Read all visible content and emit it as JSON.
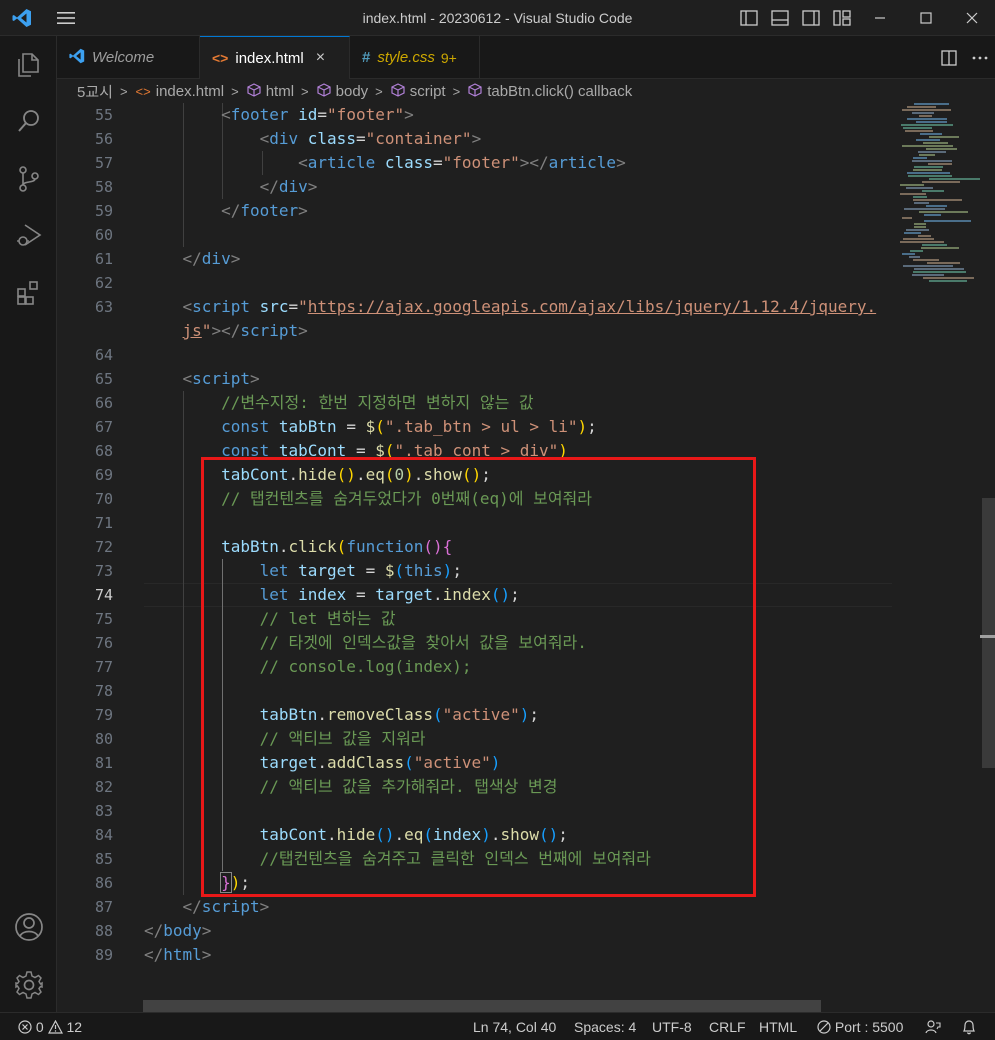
{
  "window": {
    "title": "index.html - 20230612 - Visual Studio Code"
  },
  "tabs": [
    {
      "label": "Welcome",
      "icon": "vscode-logo-icon"
    },
    {
      "label": "index.html",
      "icon": "html-icon",
      "close": "×"
    },
    {
      "label": "style.css",
      "icon": "css-icon",
      "badge": "9+"
    }
  ],
  "breadcrumb": {
    "items": [
      "5교시",
      "index.html",
      "html",
      "body",
      "script",
      "tabBtn.click() callback"
    ]
  },
  "editor": {
    "current_line": "74",
    "line_numbers": [
      "55",
      "56",
      "57",
      "58",
      "59",
      "60",
      "61",
      "62",
      "63",
      "",
      "64",
      "65",
      "66",
      "67",
      "68",
      "69",
      "70",
      "71",
      "72",
      "73",
      "74",
      "75",
      "76",
      "77",
      "78",
      "79",
      "80",
      "81",
      "82",
      "83",
      "84",
      "85",
      "86",
      "87",
      "88",
      "89"
    ]
  },
  "status": {
    "errors": "0",
    "warnings": "12",
    "position": "Ln 74, Col 40",
    "spaces": "Spaces: 4",
    "encoding": "UTF-8",
    "eol": "CRLF",
    "language": "HTML",
    "port": "Port : 5500"
  },
  "colors": {
    "accent": "#0078d4",
    "highlight_box": "#e81818",
    "keyword": "#569cd6",
    "string": "#ce9178",
    "comment": "#6a9955",
    "function": "#dcdcaa",
    "variable": "#9cdcfe"
  }
}
